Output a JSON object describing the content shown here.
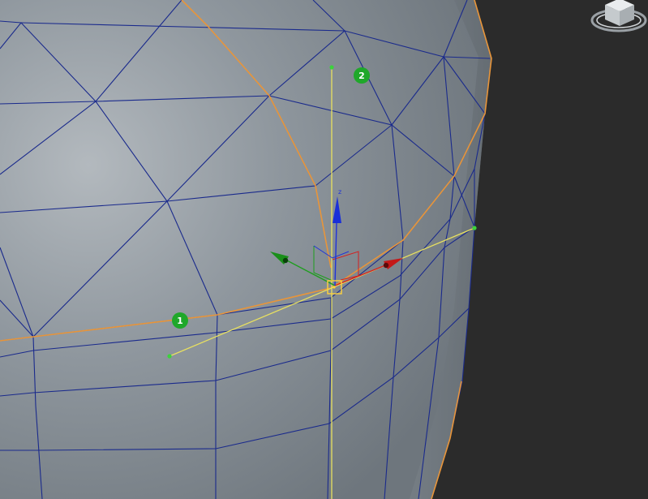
{
  "viewport": {
    "background_color": "#2b2b2b",
    "mesh_fill_color": "#8e979e",
    "wireframe_color": "#1a2a8c",
    "edge_loop_color": "#e8953a",
    "guide_line_color": "#e8e060",
    "endpoint_color": "#3cd23c",
    "selection_box_color": "#ffd23c"
  },
  "markers": [
    {
      "label": "1",
      "color": "#1fa82a"
    },
    {
      "label": "2",
      "color": "#1fa82a"
    }
  ],
  "gizmo": {
    "z_label": "z",
    "x_color": "#d42020",
    "y_color": "#1e9e1e",
    "z_color": "#2034d8"
  },
  "viewcube": {
    "icon": "viewcube-icon"
  }
}
